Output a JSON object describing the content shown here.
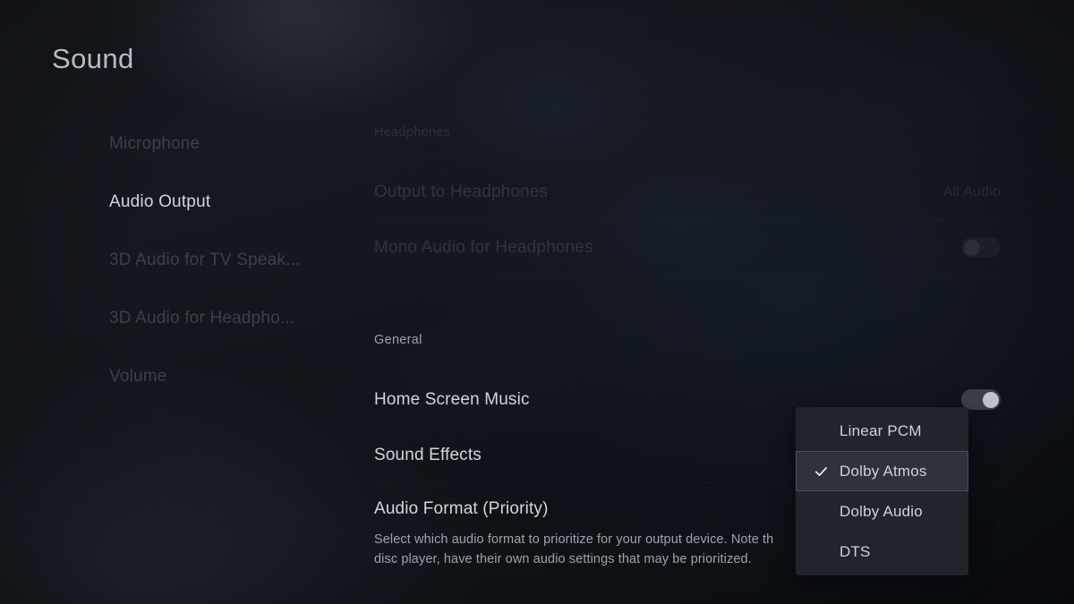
{
  "page": {
    "title": "Sound"
  },
  "sidebar": {
    "items": [
      {
        "label": "Microphone",
        "selected": false
      },
      {
        "label": "Audio Output",
        "selected": true
      },
      {
        "label": "3D Audio for TV Speak...",
        "selected": false
      },
      {
        "label": "3D Audio for Headpho...",
        "selected": false
      },
      {
        "label": "Volume",
        "selected": false
      }
    ]
  },
  "sections": {
    "headphones": {
      "heading": "Headphones",
      "rows": [
        {
          "label": "Output to Headphones",
          "value": "All Audio",
          "control": "value"
        },
        {
          "label": "Mono Audio for Headphones",
          "value": "Off",
          "control": "toggle",
          "toggle_state": "off"
        }
      ]
    },
    "general": {
      "heading": "General",
      "rows": [
        {
          "label": "Home Screen Music",
          "value": "",
          "control": "toggle",
          "toggle_state": "on"
        },
        {
          "label": "Sound Effects",
          "value": "",
          "control": "none"
        }
      ]
    }
  },
  "audio_format": {
    "title": "Audio Format (Priority)",
    "description_line1": "Select which audio format to prioritize for your output device. Note th",
    "description_line2": "disc player, have their own audio settings that may be prioritized."
  },
  "dropdown": {
    "name": "audio-format-dropdown",
    "options": [
      {
        "label": "Linear PCM",
        "selected": false
      },
      {
        "label": "Dolby Atmos",
        "selected": true
      },
      {
        "label": "Dolby Audio",
        "selected": false
      },
      {
        "label": "DTS",
        "selected": false
      }
    ],
    "check_icon": "check-icon"
  },
  "colors": {
    "background": "#14171d",
    "text_primary": "#d3d6db",
    "text_dim": "#2f343c",
    "panel": "#20242b",
    "panel_selected": "#2d323b",
    "panel_border": "#4a505c",
    "toggle_on_knob": "#bfc2c7"
  }
}
